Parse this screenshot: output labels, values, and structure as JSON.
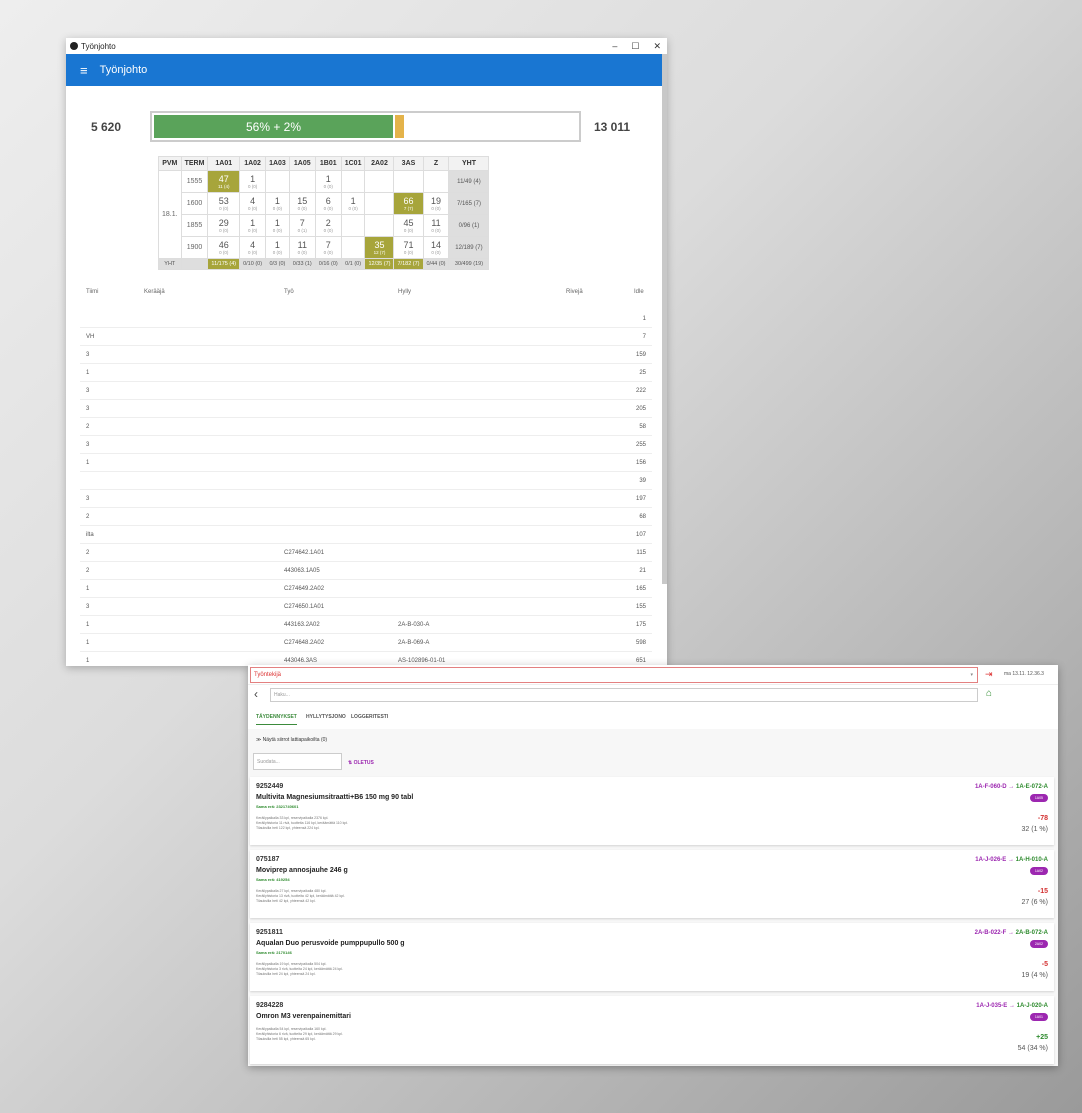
{
  "window1": {
    "title": "Työnjohto",
    "controls": [
      "–",
      "☐",
      "✕"
    ],
    "appbar_title": "Työnjohto",
    "progress": {
      "left_value": "5 620",
      "right_value": "13 011",
      "label": "56% + 2%",
      "percent": 56,
      "extra_percent": 2
    },
    "grid": {
      "headers": [
        "PVM",
        "TERM",
        "1A01",
        "1A02",
        "1A03",
        "1A05",
        "1B01",
        "1C01",
        "2A02",
        "3AS",
        "Z",
        "YHT"
      ],
      "date": "18.1.",
      "rows": [
        {
          "term": "1555",
          "cells": [
            [
              "47",
              "11 (4)",
              "hl"
            ],
            [
              "1",
              "0 (0)",
              ""
            ],
            [
              "",
              "",
              ""
            ],
            [
              "",
              "",
              ""
            ],
            [
              "1",
              "0 (0)",
              ""
            ],
            [
              "",
              "",
              ""
            ],
            [
              "",
              "",
              ""
            ],
            [
              "",
              "",
              ""
            ],
            [
              "",
              "",
              ""
            ]
          ],
          "total": "11/49 (4)"
        },
        {
          "term": "1600",
          "cells": [
            [
              "53",
              "0 (0)",
              ""
            ],
            [
              "4",
              "0 (0)",
              ""
            ],
            [
              "1",
              "0 (0)",
              ""
            ],
            [
              "15",
              "0 (0)",
              ""
            ],
            [
              "6",
              "0 (0)",
              ""
            ],
            [
              "1",
              "0 (0)",
              ""
            ],
            [
              "",
              "",
              ""
            ],
            [
              "66",
              "7 (7)",
              "hl"
            ],
            [
              "19",
              "0 (0)",
              ""
            ]
          ],
          "total": "7/165 (7)"
        },
        {
          "term": "1855",
          "cells": [
            [
              "29",
              "0 (0)",
              ""
            ],
            [
              "1",
              "0 (0)",
              ""
            ],
            [
              "1",
              "0 (0)",
              ""
            ],
            [
              "7",
              "0 (1)",
              ""
            ],
            [
              "2",
              "0 (0)",
              ""
            ],
            [
              "",
              "",
              ""
            ],
            [
              "",
              "",
              ""
            ],
            [
              "45",
              "0 (0)",
              ""
            ],
            [
              "11",
              "0 (0)",
              ""
            ]
          ],
          "total": "0/96 (1)"
        },
        {
          "term": "1900",
          "cells": [
            [
              "46",
              "0 (0)",
              ""
            ],
            [
              "4",
              "0 (0)",
              ""
            ],
            [
              "1",
              "0 (0)",
              ""
            ],
            [
              "11",
              "0 (0)",
              ""
            ],
            [
              "7",
              "0 (0)",
              ""
            ],
            [
              "",
              "",
              ""
            ],
            [
              "35",
              "12 (7)",
              "hl"
            ],
            [
              "71",
              "0 (0)",
              ""
            ],
            [
              "14",
              "0 (0)",
              ""
            ]
          ],
          "total": "12/189 (7)"
        }
      ],
      "footer_label": "YHT",
      "footer": [
        [
          "11/175 (4)",
          "hl"
        ],
        [
          "0/10 (0)",
          ""
        ],
        [
          "0/3 (0)",
          ""
        ],
        [
          "0/33 (1)",
          ""
        ],
        [
          "0/16 (0)",
          ""
        ],
        [
          "0/1 (0)",
          ""
        ],
        [
          "12/35 (7)",
          "hl"
        ],
        [
          "7/182 (7)",
          "hl"
        ],
        [
          "0/44 (0)",
          ""
        ],
        [
          "30/499 (19)",
          ""
        ]
      ]
    },
    "list_headers": {
      "tiimi": "Tiimi",
      "keraaja": "Kerääjä",
      "tyo": "Työ",
      "hylly": "Hylly",
      "riveja": "Rivejä",
      "idle": "Idle"
    },
    "list_rows": [
      {
        "tiimi": "",
        "keraaja": "",
        "tyo": "",
        "hylly": "",
        "riveja": "1"
      },
      {
        "tiimi": "VH",
        "keraaja": "",
        "tyo": "",
        "hylly": "",
        "riveja": "7"
      },
      {
        "tiimi": "3",
        "keraaja": "",
        "tyo": "",
        "hylly": "",
        "riveja": "159"
      },
      {
        "tiimi": "1",
        "keraaja": "",
        "tyo": "",
        "hylly": "",
        "riveja": "25"
      },
      {
        "tiimi": "3",
        "keraaja": "",
        "tyo": "",
        "hylly": "",
        "riveja": "222"
      },
      {
        "tiimi": "3",
        "keraaja": "",
        "tyo": "",
        "hylly": "",
        "riveja": "205"
      },
      {
        "tiimi": "2",
        "keraaja": "",
        "tyo": "",
        "hylly": "",
        "riveja": "58"
      },
      {
        "tiimi": "3",
        "keraaja": "",
        "tyo": "",
        "hylly": "",
        "riveja": "255"
      },
      {
        "tiimi": "1",
        "keraaja": "",
        "tyo": "",
        "hylly": "",
        "riveja": "156"
      },
      {
        "tiimi": "",
        "keraaja": "",
        "tyo": "",
        "hylly": "",
        "riveja": "39"
      },
      {
        "tiimi": "3",
        "keraaja": "",
        "tyo": "",
        "hylly": "",
        "riveja": "197"
      },
      {
        "tiimi": "2",
        "keraaja": "",
        "tyo": "",
        "hylly": "",
        "riveja": "68"
      },
      {
        "tiimi": "ilta",
        "keraaja": "",
        "tyo": "",
        "hylly": "",
        "riveja": "107"
      },
      {
        "tiimi": "2",
        "keraaja": "",
        "tyo": "C274642.1A01",
        "hylly": "",
        "riveja": "115"
      },
      {
        "tiimi": "2",
        "keraaja": "",
        "tyo": "443063.1A05",
        "hylly": "",
        "riveja": "21"
      },
      {
        "tiimi": "1",
        "keraaja": "",
        "tyo": "C274649.2A02",
        "hylly": "",
        "riveja": "165"
      },
      {
        "tiimi": "3",
        "keraaja": "",
        "tyo": "C274650.1A01",
        "hylly": "",
        "riveja": "155"
      },
      {
        "tiimi": "1",
        "keraaja": "",
        "tyo": "443163.2A02",
        "hylly": "2A-B-030-A",
        "riveja": "175"
      },
      {
        "tiimi": "1",
        "keraaja": "",
        "tyo": "C274648.2A02",
        "hylly": "2A-B-069-A",
        "riveja": "598"
      },
      {
        "tiimi": "1",
        "keraaja": "",
        "tyo": "443046.3AS",
        "hylly": "AS-102896-01-01",
        "riveja": "651"
      }
    ]
  },
  "window2": {
    "employee_select": "Työntekijä",
    "datetime": "ma 13.11. 12.36.3",
    "search_placeholder": "Haku...",
    "tabs": [
      "TÄYDENNYKSET",
      "HYLLYTYSJONO",
      "LOGGERITESTI"
    ],
    "toggle_label": "≫ Näytä siirrot lattiapaikoilta (0)",
    "filter_placeholder": "Suodata...",
    "sort_label": "OLETUS",
    "cards": [
      {
        "code": "9252449",
        "name": "Multivita Magnesiumsitraatti+B6 150 mg 90 tabl",
        "batch": "Sama erä: 2321740601",
        "l1": "Keräilypaikalla 33 kpl, reservipaikalla 2376 kpl.",
        "l2": "Keräilyhistoria 11 rivä, tuotteita 116 kpl, keräämättä 110 kpl.",
        "l3": "Tilauksilla heti 122 kpl, yhteensä 224 kpl.",
        "from": "1A-F-060-D",
        "to": "1A-E-072-A",
        "badge": "1A05",
        "delta": "-78",
        "delta_sign": "neg",
        "pct": "32 (1 %)"
      },
      {
        "code": "075187",
        "name": "Moviprep annosjauhe 246 g",
        "batch": "Sama erä: 419254",
        "l1": "Keräilypaikalla 27 kpl, reservipaikalla 480 kpl.",
        "l2": "Keräilyhistoria 13 rivä, tuotteita 42 kpl, keräämättä 42 kpl.",
        "l3": "Tilauksilla heti 42 kpl, yhteensä 42 kpl.",
        "from": "1A-J-026-E",
        "to": "1A-H-010-A",
        "badge": "1A02",
        "delta": "-15",
        "delta_sign": "neg",
        "pct": "27 (6 %)"
      },
      {
        "code": "9251811",
        "name": "Aqualan Duo perusvoide pumppupullo 500 g",
        "batch": "Sama erä: 2170146",
        "l1": "Keräilypaikalla 19 kpl, reservipaikalla 504 kpl.",
        "l2": "Keräilyhistoria 3 rivä, tuotteita 24 kpl, keräämättä 24 kpl.",
        "l3": "Tilauksilla heti 24 kpl, yhteensä 24 kpl.",
        "from": "2A-B-022-F",
        "to": "2A-B-072-A",
        "badge": "2A02",
        "delta": "-5",
        "delta_sign": "neg",
        "pct": "19 (4 %)"
      },
      {
        "code": "9284228",
        "name": "Omron M3 verenpainemittari",
        "batch": "",
        "l1": "Keräilypaikalla 54 kpl, reservipaikalla 160 kpl.",
        "l2": "Keräilyhistoria 6 rivä, tuotteita 29 kpl, keräämättä 29 kpl.",
        "l3": "Tilauksilla heti 55 kpl, yhteensä 65 kpl.",
        "from": "1A-J-035-E",
        "to": "1A-J-020-A",
        "badge": "1A01",
        "delta": "+25",
        "delta_sign": "pos",
        "pct": "54 (34 %)"
      }
    ]
  }
}
